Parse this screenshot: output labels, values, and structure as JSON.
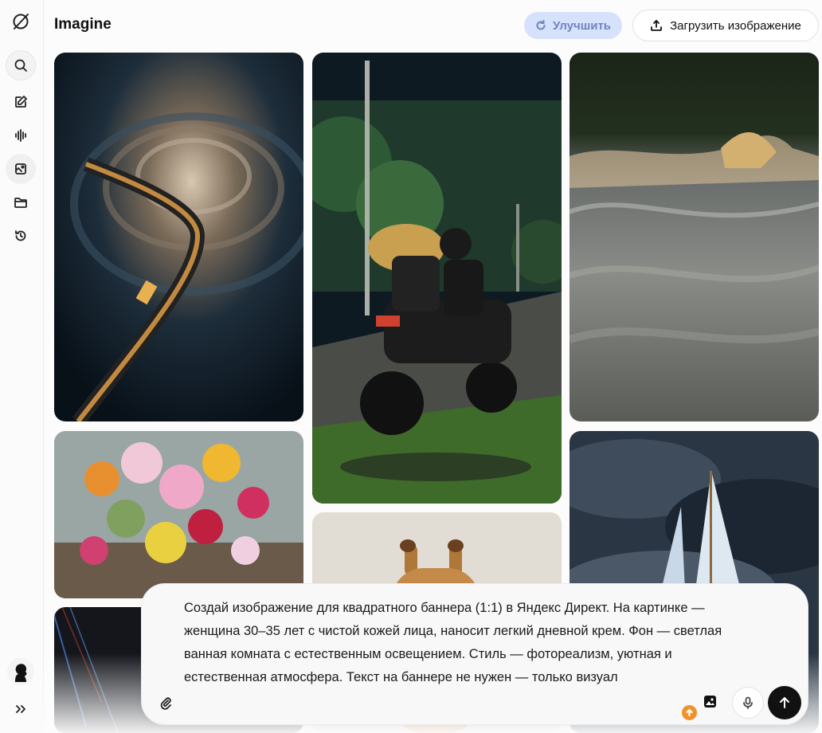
{
  "app": {
    "title": "Imagine"
  },
  "sidebar": {
    "items": [
      {
        "icon": "logo-icon"
      },
      {
        "icon": "search-icon"
      },
      {
        "icon": "edit-icon"
      },
      {
        "icon": "voice-icon"
      },
      {
        "icon": "imagine-icon"
      },
      {
        "icon": "folder-icon"
      },
      {
        "icon": "history-icon"
      }
    ],
    "expand_icon": "chevrons-right-icon",
    "avatar_icon": "avatar-icon"
  },
  "header": {
    "improve_label": "Улучшить",
    "upload_label": "Загрузить изображение"
  },
  "gallery": {
    "tiles": [
      {
        "subject": "train-spiral"
      },
      {
        "subject": "motorcycle-night"
      },
      {
        "subject": "ocean-wave"
      },
      {
        "subject": "flower-bouquet"
      },
      {
        "subject": "giraffe"
      },
      {
        "subject": "sailboat-storm"
      },
      {
        "subject": "abstract-dark"
      }
    ]
  },
  "composer": {
    "text": "Создай изображение для квадратного баннера (1:1) в Яндекс Директ. На картинке — женщина 30–35 лет с чистой кожей лица, наносит легкий дневной крем. Фон — светлая ванная комната с естественным освещением. Стиль — фотореализм, уютная и естественная атмосфера. Текст на баннере не нужен — только визуал",
    "attach_icon": "paperclip-icon",
    "image_icon": "image-icon",
    "mic_icon": "mic-icon",
    "send_icon": "send-arrow-icon"
  },
  "colors": {
    "accent": "#d6e1fb",
    "accent_text": "#6f86b8",
    "badge": "#f0912b"
  }
}
